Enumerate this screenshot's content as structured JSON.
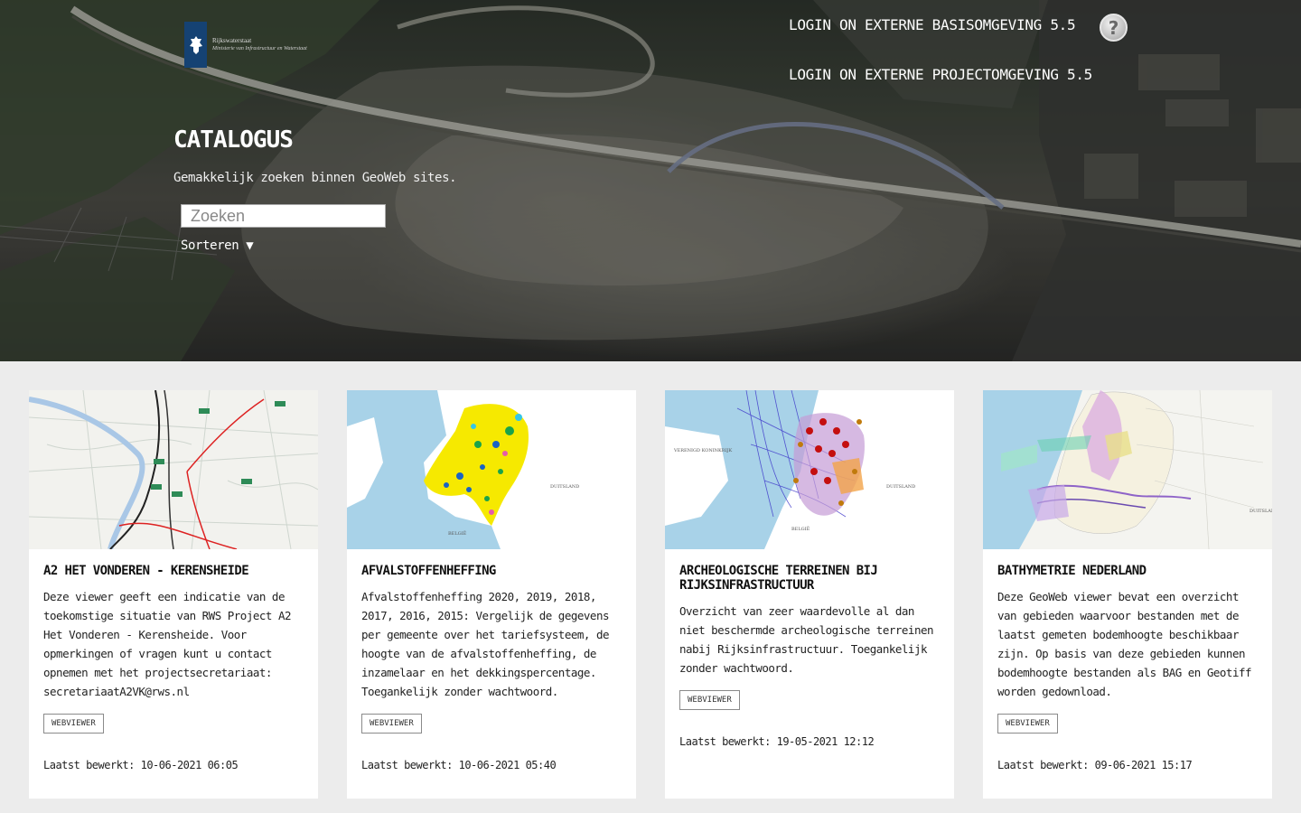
{
  "header": {
    "logo": {
      "line1": "Rijkswaterstaat",
      "line2": "Ministerie van Infrastructuur en Waterstaat"
    },
    "links": [
      {
        "label": "LOGIN ON EXTERNE BASISOMGEVING 5.5"
      },
      {
        "label": "LOGIN ON EXTERNE PROJECTOMGEVING 5.5"
      }
    ],
    "help_icon": "question-mark-icon"
  },
  "hero": {
    "title": "CATALOGUS",
    "subtitle": "Gemakkelijk zoeken binnen GeoWeb sites.",
    "search_placeholder": "Zoeken",
    "sort_label": "Sorteren ▼"
  },
  "cards": [
    {
      "title": "A2 HET VONDEREN - KERENSHEIDE",
      "description": "Deze viewer geeft een indicatie van de toekomstige situatie van RWS Project A2 Het Vonderen - Kerensheide. Voor opmerkingen of vragen kunt u contact opnemen met het projectsecretariaat: secretariaatA2VK@rws.nl",
      "button": "WEBVIEWER",
      "edited": "Laatst bewerkt: 10-06-2021 06:05"
    },
    {
      "title": "AFVALSTOFFENHEFFING",
      "description": "Afvalstoffenheffing 2020, 2019, 2018, 2017, 2016, 2015: Vergelijk de gegevens per gemeente over het tariefsysteem, de hoogte van de afvalstoffenheffing, de inzamelaar en het dekkingspercentage. Toegankelijk zonder wachtwoord.",
      "button": "WEBVIEWER",
      "edited": "Laatst bewerkt: 10-06-2021 05:40"
    },
    {
      "title": "ARCHEOLOGISCHE TERREINEN BIJ RIJKSINFRASTRUCTUUR",
      "description": "Overzicht van zeer waardevolle al dan niet beschermde archeologische terreinen nabij Rijksinfrastructuur. Toegankelijk zonder wachtwoord.",
      "button": "WEBVIEWER",
      "edited": "Laatst bewerkt: 19-05-2021 12:12"
    },
    {
      "title": "BATHYMETRIE NEDERLAND",
      "description": "Deze GeoWeb viewer bevat een overzicht van gebieden waarvoor bestanden met de laatst gemeten bodemhoogte beschikbaar zijn. Op basis van deze gebieden kunnen bodemhoogte bestanden als BAG en Geotiff worden gedownload.",
      "button": "WEBVIEWER",
      "edited": "Laatst bewerkt: 09-06-2021 15:17"
    }
  ],
  "map_labels": {
    "duitsland": "DUITSLAND",
    "belgie": "BELGIË",
    "vk": "VERENIGD KONINKRIJK"
  }
}
